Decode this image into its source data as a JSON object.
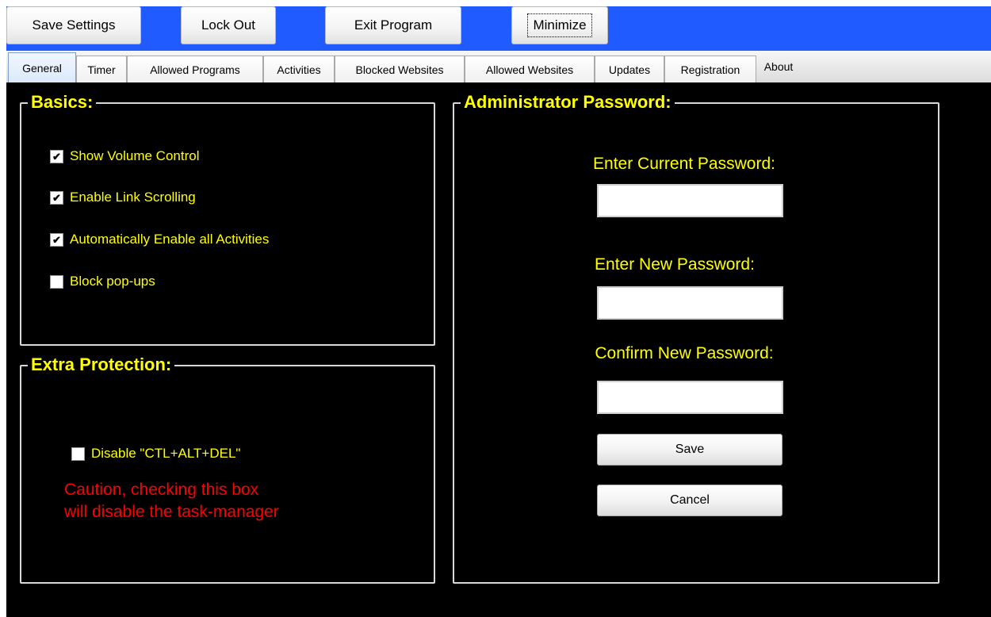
{
  "toolbar": {
    "save_settings": "Save Settings",
    "lock_out": "Lock Out",
    "exit_program": "Exit Program",
    "minimize": "Minimize"
  },
  "tabs": [
    "General",
    "Timer",
    "Allowed Programs",
    "Activities",
    "Blocked Websites",
    "Allowed Websites",
    "Updates",
    "Registration",
    "About"
  ],
  "active_tab": "General",
  "basics": {
    "title": "Basics:",
    "options": [
      {
        "label": "Show Volume Control",
        "checked": true
      },
      {
        "label": "Enable Link Scrolling",
        "checked": true
      },
      {
        "label": "Automatically Enable all Activities",
        "checked": true
      },
      {
        "label": "Block pop-ups",
        "checked": false
      }
    ]
  },
  "extra": {
    "title": "Extra Protection:",
    "option": {
      "label": "Disable \"CTL+ALT+DEL\"",
      "checked": false
    },
    "warning_line1": "Caution, checking this box",
    "warning_line2": "will disable the task-manager"
  },
  "admin": {
    "title": "Administrator Password:",
    "current_label": "Enter Current Password:",
    "current_value": "",
    "new_label": "Enter New Password:",
    "new_value": "",
    "confirm_label": "Confirm New Password:",
    "confirm_value": "",
    "save": "Save",
    "cancel": "Cancel"
  },
  "colors": {
    "toolbar_bg": "#1f5bff",
    "panel_bg": "#000000",
    "label_text": "#ffff00",
    "warning_text": "#ff0000"
  }
}
